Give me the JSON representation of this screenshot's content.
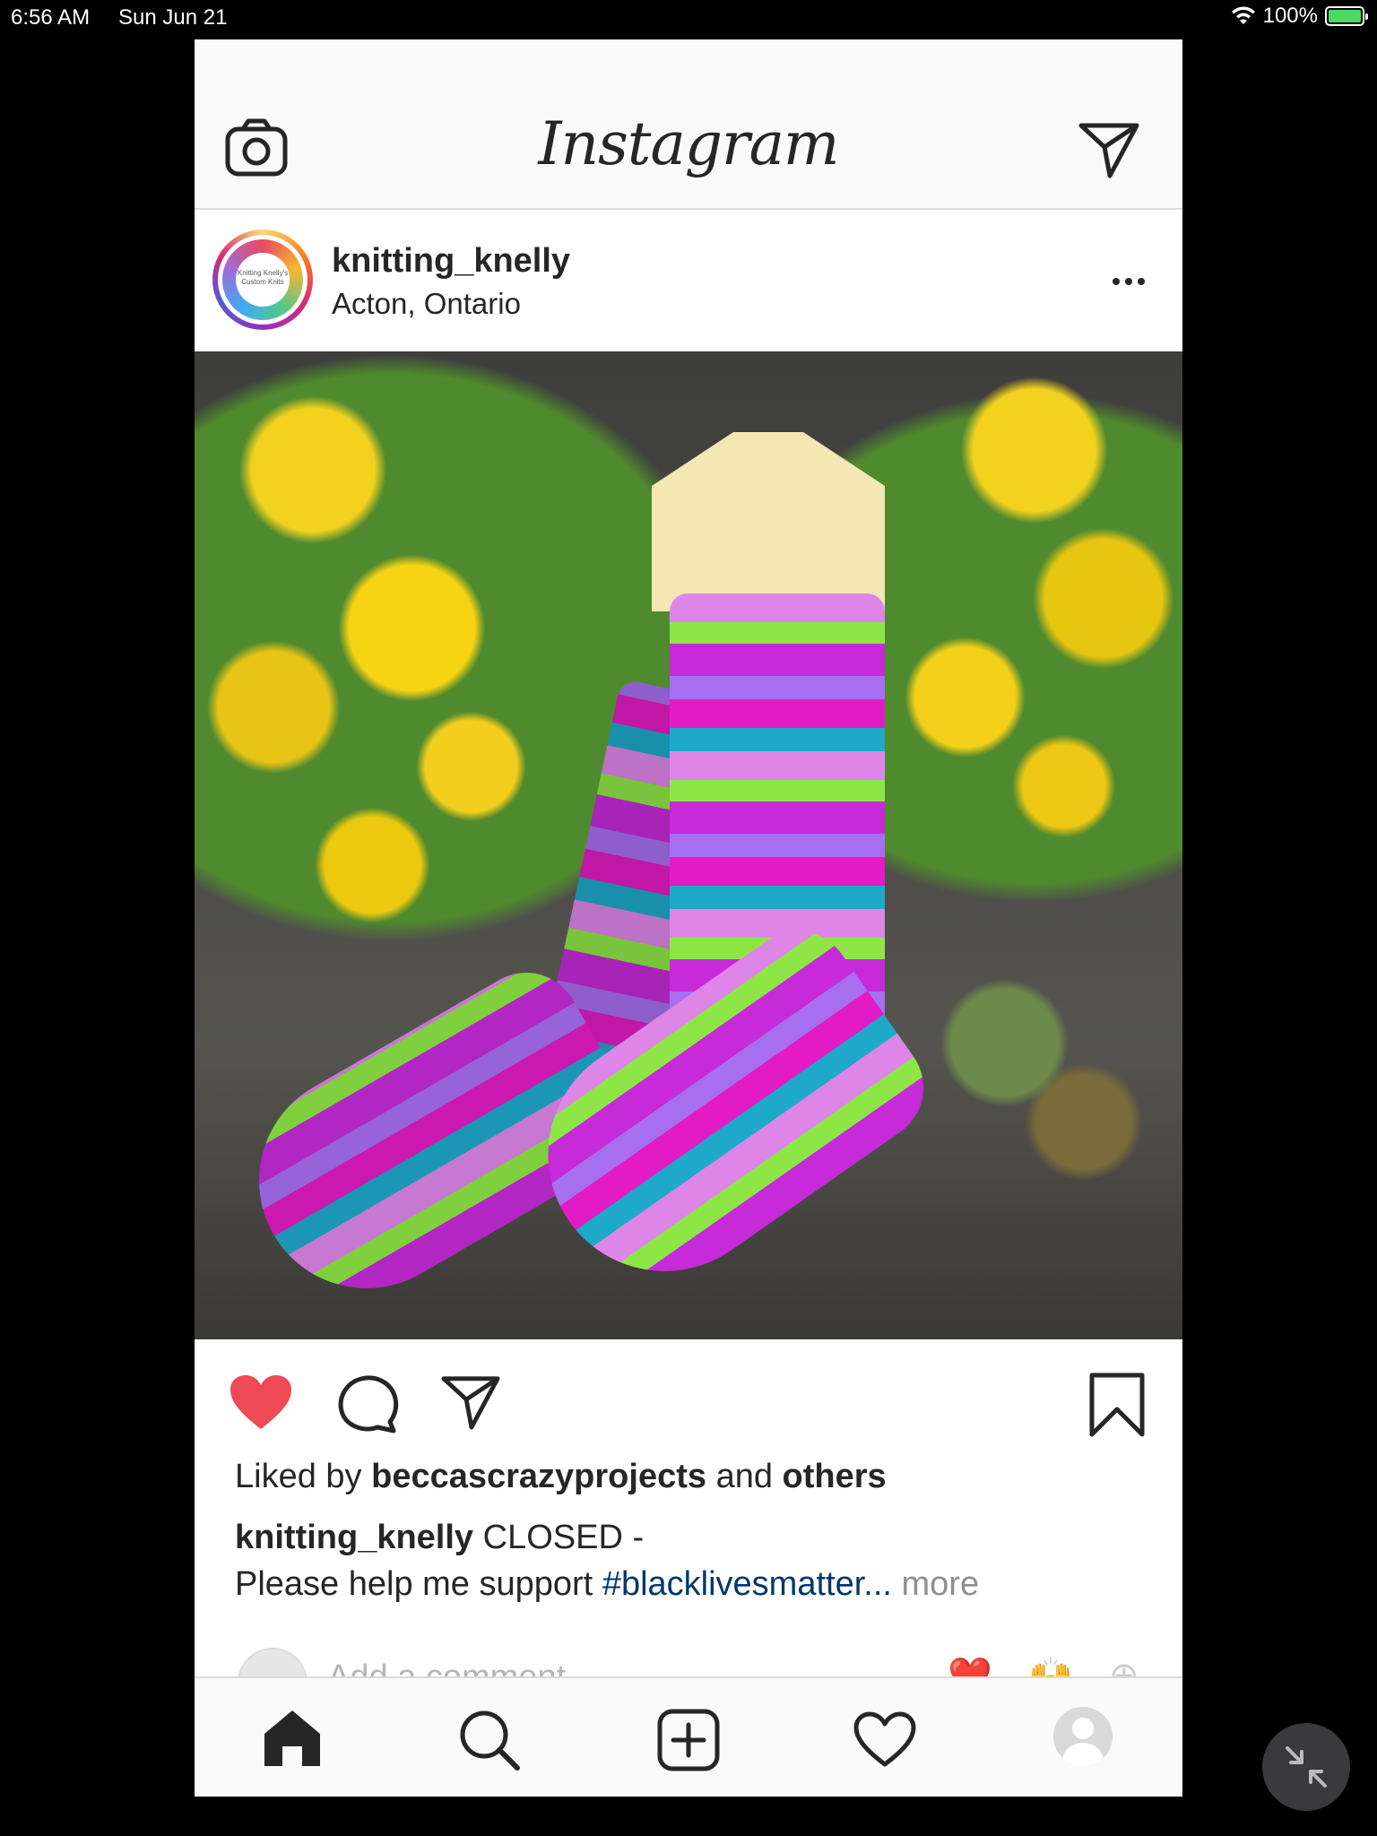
{
  "status_bar": {
    "time": "6:56 AM",
    "date": "Sun Jun 21",
    "battery_percent": "100%",
    "icons": [
      "wifi-icon",
      "battery-charging-icon"
    ]
  },
  "top_nav": {
    "logo": "Instagram",
    "left_icon": "camera-icon",
    "right_icon": "direct-message-icon"
  },
  "post": {
    "username": "knitting_knelly",
    "location": "Acton, Ontario",
    "avatar_text": "Knitting Knelly's Custom Knits",
    "image_description_icon": "post-photo",
    "liked": true,
    "liked_by_prefix": "Liked by",
    "liked_by_user": "beccascrazyprojects",
    "liked_by_mid": "and",
    "liked_by_suffix": "others",
    "caption_user": "knitting_knelly",
    "caption_text": "CLOSED -",
    "caption_line2": "Please help me support",
    "caption_hashtag": "#blacklivesmatter...",
    "caption_more": "more",
    "comment_placeholder": "Add a comment",
    "quick_emojis": [
      "❤️",
      "🙌",
      "⊕"
    ]
  },
  "bottom_nav": {
    "items": [
      "home-icon",
      "search-icon",
      "new-post-icon",
      "activity-heart-icon",
      "profile-avatar"
    ]
  },
  "colors": {
    "like_red": "#ed4956",
    "hashtag_blue": "#00376b",
    "text_dark": "#262626",
    "muted": "#8e8e8e"
  }
}
